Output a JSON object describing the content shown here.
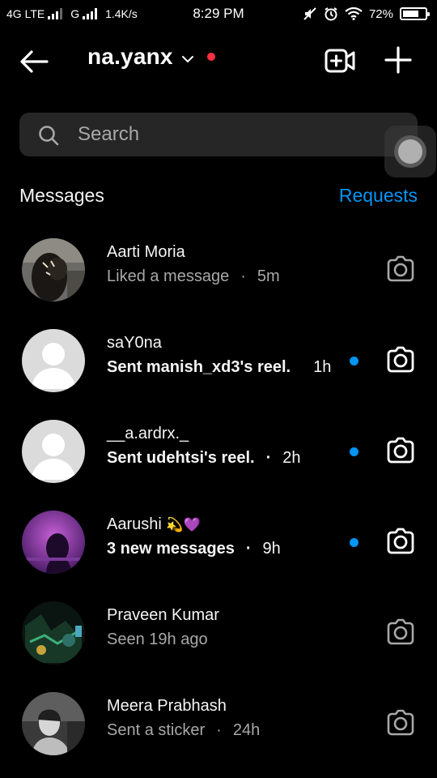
{
  "status_bar": {
    "network_left": "4G LTE",
    "network_g": "G",
    "speed": "1.4K/s",
    "time": "8:29 PM",
    "battery": "72%",
    "battery_level": 0.72
  },
  "header": {
    "username": "na.yanx",
    "indicator_color": "#ff3040"
  },
  "search": {
    "placeholder": "Search",
    "value": ""
  },
  "messages_section": {
    "title": "Messages",
    "requests_label": "Requests",
    "accent_color": "#0095f6"
  },
  "conversations": [
    {
      "name": "Aarti Moria",
      "preview": "Liked a message",
      "separator": "·",
      "time": "5m",
      "unread": false
    },
    {
      "name": "saY0na",
      "preview": "Sent manish_xd3's reel.",
      "separator": "",
      "time": "1h",
      "unread": true
    },
    {
      "name": "__a.ardrx._",
      "preview": "Sent udehtsi's reel.",
      "separator": "·",
      "time": "2h",
      "unread": true
    },
    {
      "name": "Aarushi",
      "name_emoji": "💫💜",
      "preview": "3 new messages",
      "separator": "·",
      "time": "9h",
      "unread": true
    },
    {
      "name": "Praveen Kumar",
      "preview": "Seen 19h ago",
      "separator": "",
      "time": "",
      "unread": false
    },
    {
      "name": "Meera Prabhash",
      "preview": "Sent a sticker",
      "separator": "·",
      "time": "24h",
      "unread": false
    }
  ]
}
